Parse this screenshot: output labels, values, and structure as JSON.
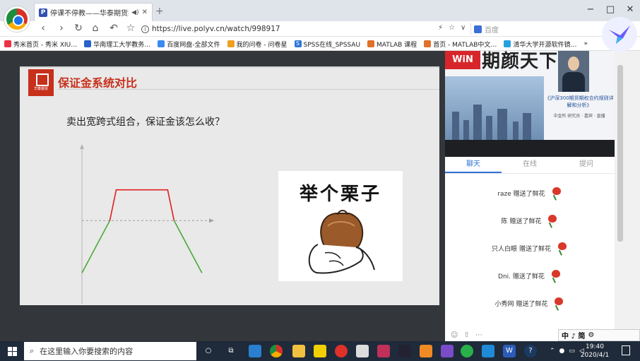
{
  "browser": {
    "tab_title": "停课不停教——华泰期货的讲座",
    "new_tab": "+",
    "window_controls": [
      "−",
      "□",
      "✕"
    ],
    "url": "https://live.polyv.cn/watch/998917",
    "search_placeholder": "百度",
    "bookmarks": [
      "秀米首页 - 秀米 XIU…",
      "华南理工大学教务…",
      "百度网盘-全部文件",
      "我的问卷 - 问卷星",
      "SPSS在线_SPSSAU",
      "MATLAB 课程",
      "首页 - MATLAB中文…",
      "清华大学开源软件镜…"
    ]
  },
  "slide": {
    "title": "保证金系统对比",
    "logo_text": "华泰期货",
    "question": "卖出宽跨式组合，保证金该怎么收？",
    "meme_caption": "举个栗子",
    "colors": {
      "accent": "#c7301b",
      "profit": "#e02020",
      "loss": "#4aa83a"
    }
  },
  "chart_data": {
    "type": "line",
    "series": [
      {
        "name": "",
        "color": "#4aa83a",
        "x": [
          0,
          1.3
        ],
        "y": [
          -1,
          0.7
        ]
      },
      {
        "name": "",
        "color": "#e02020",
        "x": [
          1.3,
          1.6,
          4.0,
          4.3
        ],
        "y": [
          0.7,
          1.7,
          1.7,
          0.7
        ]
      },
      {
        "name": "",
        "color": "#4aa83a",
        "x": [
          4.3,
          5.6
        ],
        "y": [
          0.7,
          -1
        ]
      }
    ],
    "baseline": 0.7,
    "xlim": [
      0,
      6
    ],
    "ylim": [
      -2,
      3
    ],
    "title": "",
    "xlabel": "",
    "ylabel": ""
  },
  "side": {
    "banner": "期颜天下",
    "book_title": "《沪深300期货期权合约规则详解和分析》",
    "book_meta": "中金所 研究员 · 嘉宾 · 直播",
    "tabs": [
      "聊天",
      "在线",
      "提问"
    ],
    "messages": [
      {
        "user": "raze",
        "action": "赠送了鲜花"
      },
      {
        "user": "陈",
        "action": "赠送了鲜花"
      },
      {
        "user": "只人白眼",
        "action": "赠送了鲜花"
      },
      {
        "user": "Dni.",
        "action": "赠送了鲜花"
      },
      {
        "user": "小秀网",
        "action": "赠送了鲜花"
      }
    ],
    "ime": "中 ♪ 简"
  },
  "taskbar": {
    "search_placeholder": "在这里输入你要搜索的内容",
    "time": "19:40",
    "date": "2020/4/1"
  }
}
